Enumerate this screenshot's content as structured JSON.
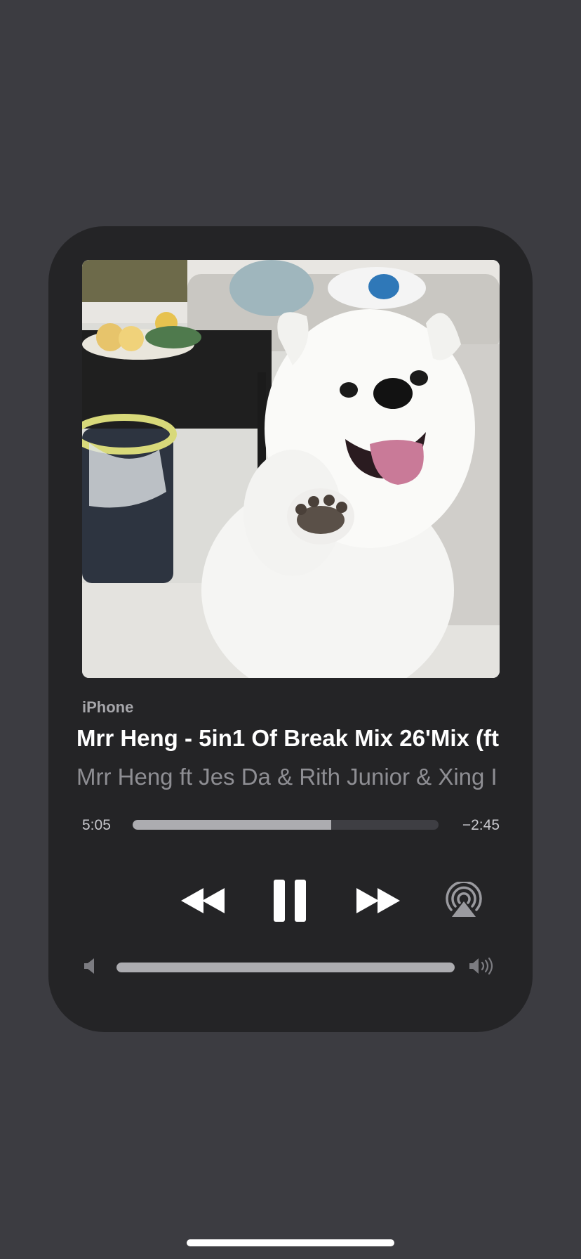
{
  "player": {
    "source_label": "iPhone",
    "track_title": "Mrr Heng - 5in1 Of Break Mix 26'Mix (ft",
    "artist": "Mrr Heng ft Jes Da & Rith Junior & Xing I",
    "time_elapsed": "5:05",
    "time_remaining": "−2:45",
    "progress_fraction": 0.65,
    "volume_fraction": 1.0,
    "is_playing": true,
    "artwork_icon": "white-puppy-photo"
  },
  "controls": {
    "rewind_icon": "rewind-icon",
    "pause_icon": "pause-icon",
    "forward_icon": "fast-forward-icon",
    "airplay_icon": "airplay-icon",
    "volume_low_icon": "speaker-low-icon",
    "volume_high_icon": "speaker-high-icon"
  },
  "colors": {
    "background": "#3c3c41",
    "card": "#242426",
    "accent_fill": "#acacb0",
    "text_primary": "#ffffff",
    "text_secondary": "#8e8e93"
  }
}
